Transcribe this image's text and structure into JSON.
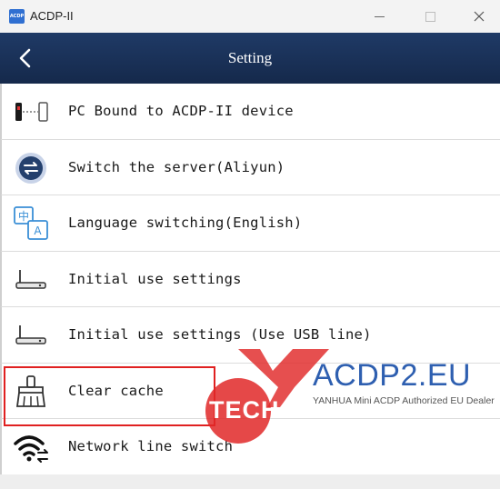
{
  "window": {
    "title": "ACDP-II",
    "icon_text": "ACDP",
    "icons": [
      "app-icon",
      "minimize-icon",
      "maximize-icon",
      "close-icon"
    ]
  },
  "header": {
    "title": "Setting",
    "back_icon": "chevron-left-icon"
  },
  "settings": [
    {
      "label": "PC Bound to ACDP-II device",
      "icon": "device-bind-icon"
    },
    {
      "label": "Switch the server(Aliyun)",
      "icon": "server-switch-icon"
    },
    {
      "label": "Language switching(English)",
      "icon": "language-icon"
    },
    {
      "label": "Initial use settings",
      "icon": "router-icon"
    },
    {
      "label": "Initial use settings (Use USB line)",
      "icon": "router-icon"
    },
    {
      "label": "Clear cache",
      "icon": "broom-icon"
    },
    {
      "label": "Network line switch",
      "icon": "wifi-switch-icon"
    }
  ],
  "highlighted_item": "Clear cache",
  "colors": {
    "header_bg": "#1b3359",
    "highlight_border": "#e02020",
    "watermark_red": "#e12828",
    "watermark_blue": "#2e5fb0"
  },
  "watermark": {
    "logo_text": "TECH",
    "brand": "ACDP2.EU",
    "tagline": "YANHUA Mini ACDP Authorized EU Dealer"
  }
}
